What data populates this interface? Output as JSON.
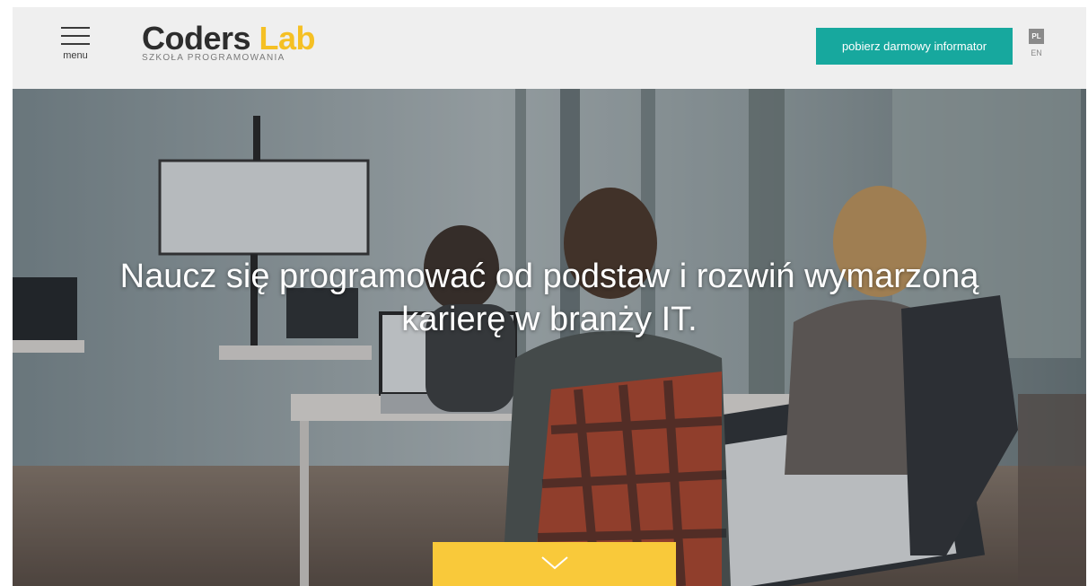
{
  "header": {
    "menu_label": "menu",
    "logo": {
      "word1": "Coders",
      "word2": "Lab",
      "tagline": "SZKOŁA  PROGRAMOWANIA"
    },
    "cta_label": "pobierz darmowy informator",
    "languages": {
      "active": "PL",
      "other": "EN"
    }
  },
  "hero": {
    "headline": "Naucz się programować od podstaw i rozwiń wymarzoną karierę w branży IT.",
    "scroll_icon": "chevron-down-icon"
  },
  "colors": {
    "header_bg": "#efefef",
    "brand_dark": "#2d2d2d",
    "brand_yellow": "#f5c024",
    "cta_teal": "#17a89e",
    "scroll_yellow": "#f9c93a"
  }
}
